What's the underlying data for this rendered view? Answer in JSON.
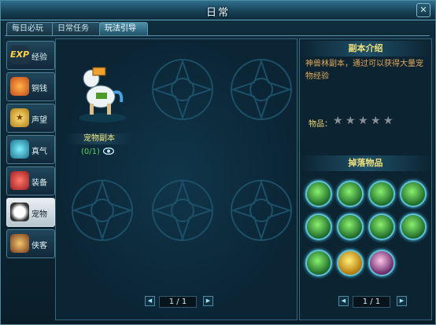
{
  "window": {
    "title": "日常"
  },
  "tabs": [
    {
      "label": "每日必玩",
      "active": false
    },
    {
      "label": "日常任务",
      "active": false
    },
    {
      "label": "玩法引导",
      "active": true
    }
  ],
  "sidebar": {
    "items": [
      {
        "label": "经验",
        "icon": "exp-icon",
        "active": false
      },
      {
        "label": "铜钱",
        "icon": "coin-bag-icon",
        "active": false
      },
      {
        "label": "声望",
        "icon": "trophy-icon",
        "active": false
      },
      {
        "label": "真气",
        "icon": "spirit-icon",
        "active": false
      },
      {
        "label": "装备",
        "icon": "armor-icon",
        "active": false
      },
      {
        "label": "宠物",
        "icon": "panda-icon",
        "active": true
      },
      {
        "label": "侠客",
        "icon": "hero-icon",
        "active": false
      }
    ]
  },
  "dungeon": {
    "name": "宠物副本",
    "progress": "(0/1)"
  },
  "main_pager": {
    "page": "1 / 1"
  },
  "intro": {
    "header": "副本介绍",
    "description": "神兽林副本，通过可以获得大量宠物经验",
    "item_label": "物品：",
    "star_rating": 5
  },
  "drops": {
    "header": "掉落物品",
    "count": 11
  },
  "drops_pager": {
    "page": "1 / 1"
  },
  "colors": {
    "accent": "#f2e37a",
    "progress": "#58d35a",
    "desc": "#e2a95a",
    "border": "#4f8aa3"
  }
}
